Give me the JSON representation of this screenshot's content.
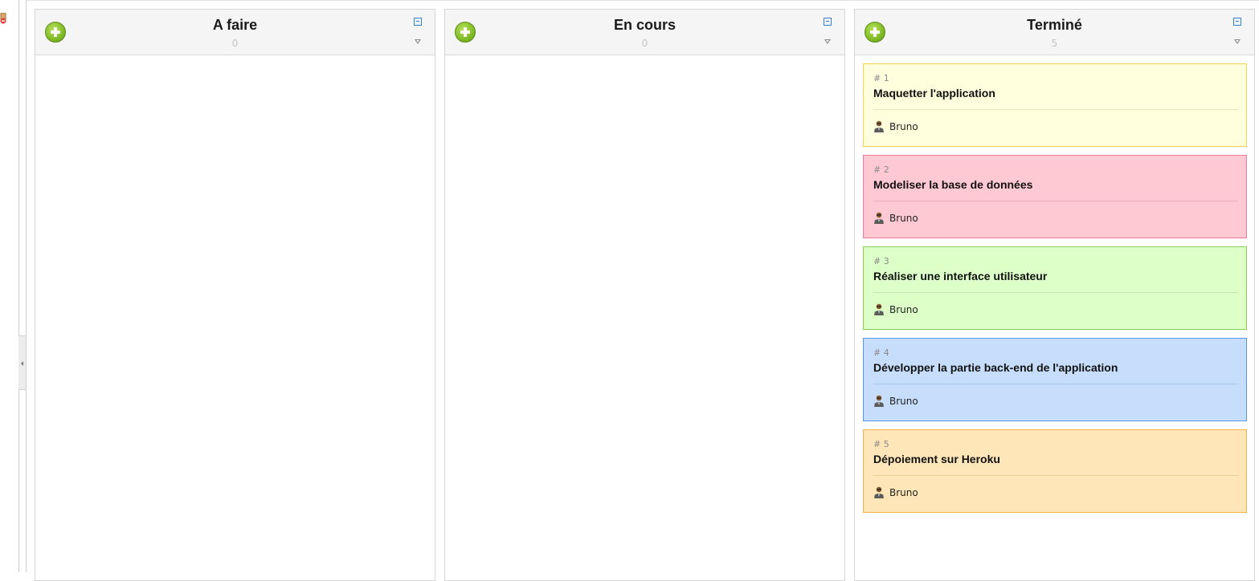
{
  "board": {
    "columns": [
      {
        "title": "A faire",
        "count": "0"
      },
      {
        "title": "En cours",
        "count": "0"
      },
      {
        "title": "Terminé",
        "count": "5"
      }
    ],
    "cards": [
      {
        "number": "# 1",
        "title": "Maquetter l'application",
        "assignee": "Bruno",
        "bg": "#fffedd",
        "border": "#f2d350",
        "sep": "#ece7b8"
      },
      {
        "number": "# 2",
        "title": "Modeliser la base de données",
        "assignee": "Bruno",
        "bg": "#ffc9d4",
        "border": "#ec7d95",
        "sep": "#f0adbb"
      },
      {
        "number": "# 3",
        "title": "Réaliser une interface utilisateur",
        "assignee": "Bruno",
        "bg": "#ddffc8",
        "border": "#88cc55",
        "sep": "#c3e9ad"
      },
      {
        "number": "# 4",
        "title": "Développer la partie back-end de l'application",
        "assignee": "Bruno",
        "bg": "#c6defc",
        "border": "#5596e8",
        "sep": "#a9c9f0"
      },
      {
        "number": "# 5",
        "title": "Dépoiement sur Heroku",
        "assignee": "Bruno",
        "bg": "#ffe6b8",
        "border": "#f0b24b",
        "sep": "#efcf97"
      }
    ]
  },
  "icons": {
    "add": "add-circle-icon",
    "minimize": "minimize-icon",
    "dropdown": "dropdown-arrow-icon",
    "user": "user-icon"
  }
}
